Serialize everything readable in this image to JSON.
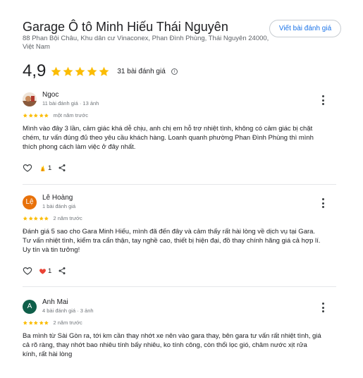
{
  "place": {
    "title": "Garage Ô tô Minh Hiếu Thái Nguyên",
    "address": "88 Phan Bội Châu, Khu dân cư Vinaconex, Phan Đình Phùng, Thái Nguyên 24000, Việt Nam",
    "write_review_label": "Viết bài đánh giá",
    "rating": "4,9",
    "rating_stars": 5,
    "review_count_label": "31 bài đánh giá",
    "info_icon": "i"
  },
  "colors": {
    "star": "#fbbc04",
    "accent": "#1a73e8",
    "avatar_le": "#e8710a",
    "avatar_anh": "#0f5f4a",
    "heart_red": "#ea4335"
  },
  "reviews": [
    {
      "author": "Ngoc",
      "avatar_icon": "photo-avatar",
      "meta": "11 bài đánh giá · 13 ảnh",
      "stars": 5,
      "time": "một năm trước",
      "text": "Mình vào đây 3 lần, cảm giác khá dễ chịu, anh chị em hỗ trợ nhiệt tình, không có cảm giác bị chặt chém, tư vấn đúng đủ theo yêu cầu khách hàng. Loanh quanh phường Phan Đình Phùng thì mình thích phong cách làm việc ở đây nhất.",
      "reaction_count": "1",
      "reaction_icon": "clap-icon"
    },
    {
      "author": "Lê Hoàng",
      "avatar_letter": "Lệ",
      "meta": "1 bài đánh giá",
      "stars": 5,
      "time": "2 năm trước",
      "text": "Đánh giá 5 sao cho Gara Minh Hiếu, mình đã đến đây và cảm thấy rất hài lòng về dịch vụ tại Gara. Tư vấn nhiệt tình, kiểm tra cẩn thận, tay nghề cao, thiết bị hiện đại, đồ thay chính hãng giá cả hợp lí. Uy tín và tin tưởng!",
      "reaction_count": "1",
      "reaction_icon": "heart-icon"
    },
    {
      "author": "Anh Mai",
      "avatar_letter": "A",
      "meta": "4 bài đánh giá · 3 ảnh",
      "stars": 5,
      "time": "2 năm trước",
      "text": "Ba mình từ Sài Gòn ra, tới km cần thay nhớt xe nên vào gara thay, bên gara tư vấn rất nhiệt tình, giá cả rõ ràng, thay nhớt bao nhiêu tính bấy nhiêu, ko tính công, còn thổi lọc gió, châm nước xịt rửa kính, rất hài lòng"
    }
  ]
}
